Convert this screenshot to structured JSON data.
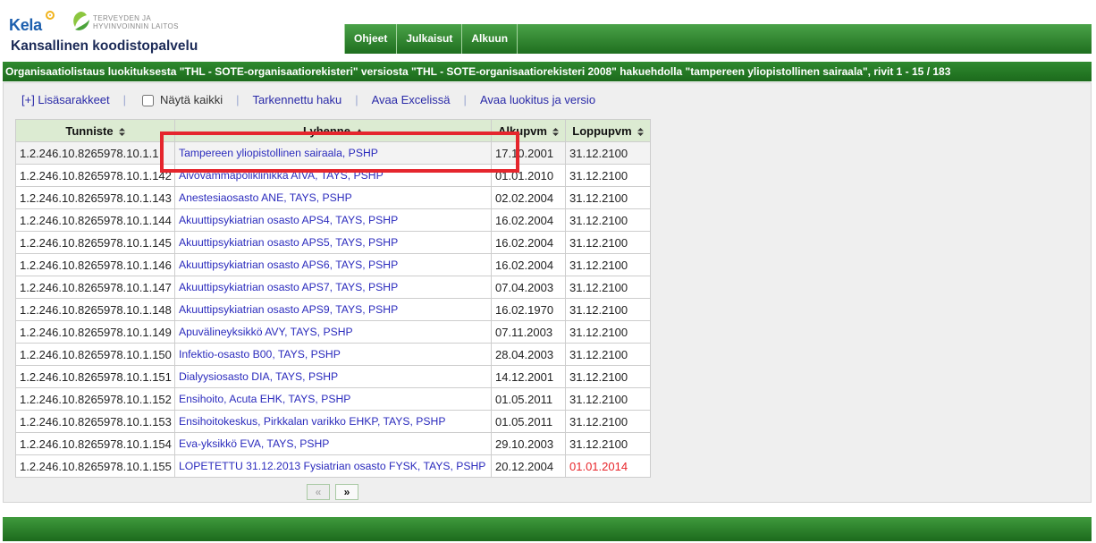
{
  "header": {
    "kela_logo_text": "Kela",
    "thl_logo_line1": "TERVEYDEN JA",
    "thl_logo_line2": "HYVINVOINNIN LAITOS",
    "app_title": "Kansallinen koodistopalvelu"
  },
  "nav": {
    "items": [
      {
        "label": "Ohjeet"
      },
      {
        "label": "Julkaisut"
      },
      {
        "label": "Alkuun"
      }
    ]
  },
  "title_bar": {
    "text": "Organisaatiolistaus luokituksesta \"THL - SOTE-organisaatiorekisteri\" versiosta \"THL - SOTE-organisaatiorekisteri 2008\" hakuehdolla \"tampereen yliopistollinen sairaala\", rivit 1 - 15 / 183"
  },
  "toolbar": {
    "more_columns": "[+] Lisäsarakkeet",
    "separator": "|",
    "show_all_label": "Näytä kaikki",
    "show_all_checked": false,
    "advanced_search": "Tarkennettu haku",
    "open_excel": "Avaa Excelissä",
    "open_classification": "Avaa luokitus ja versio"
  },
  "table": {
    "columns": [
      {
        "label": "Tunniste",
        "sort_icon": "sort-both-icon"
      },
      {
        "label": "Lyhenne",
        "sort_icon": "sort-asc-icon"
      },
      {
        "label": "Alkupvm",
        "sort_icon": "sort-both-icon"
      },
      {
        "label": "Loppupvm",
        "sort_icon": "sort-both-icon"
      }
    ],
    "rows": [
      {
        "id": "1.2.246.10.8265978.10.1.1",
        "name": "Tampereen yliopistollinen sairaala, PSHP",
        "start": "17.10.2001",
        "end": "31.12.2100",
        "end_expired": false
      },
      {
        "id": "1.2.246.10.8265978.10.1.142",
        "name": "Aivovammapoliklinikka AIVA, TAYS, PSHP",
        "start": "01.01.2010",
        "end": "31.12.2100",
        "end_expired": false
      },
      {
        "id": "1.2.246.10.8265978.10.1.143",
        "name": "Anestesiaosasto ANE, TAYS, PSHP",
        "start": "02.02.2004",
        "end": "31.12.2100",
        "end_expired": false
      },
      {
        "id": "1.2.246.10.8265978.10.1.144",
        "name": "Akuuttipsykiatrian osasto APS4, TAYS, PSHP",
        "start": "16.02.2004",
        "end": "31.12.2100",
        "end_expired": false
      },
      {
        "id": "1.2.246.10.8265978.10.1.145",
        "name": "Akuuttipsykiatrian osasto APS5, TAYS, PSHP",
        "start": "16.02.2004",
        "end": "31.12.2100",
        "end_expired": false
      },
      {
        "id": "1.2.246.10.8265978.10.1.146",
        "name": "Akuuttipsykiatrian osasto APS6, TAYS, PSHP",
        "start": "16.02.2004",
        "end": "31.12.2100",
        "end_expired": false
      },
      {
        "id": "1.2.246.10.8265978.10.1.147",
        "name": "Akuuttipsykiatrian osasto APS7, TAYS, PSHP",
        "start": "07.04.2003",
        "end": "31.12.2100",
        "end_expired": false
      },
      {
        "id": "1.2.246.10.8265978.10.1.148",
        "name": "Akuuttipsykiatrian osasto APS9, TAYS, PSHP",
        "start": "16.02.1970",
        "end": "31.12.2100",
        "end_expired": false
      },
      {
        "id": "1.2.246.10.8265978.10.1.149",
        "name": "Apuvälineyksikkö AVY, TAYS, PSHP",
        "start": "07.11.2003",
        "end": "31.12.2100",
        "end_expired": false
      },
      {
        "id": "1.2.246.10.8265978.10.1.150",
        "name": "Infektio-osasto B00, TAYS, PSHP",
        "start": "28.04.2003",
        "end": "31.12.2100",
        "end_expired": false
      },
      {
        "id": "1.2.246.10.8265978.10.1.151",
        "name": "Dialyysiosasto DIA, TAYS, PSHP",
        "start": "14.12.2001",
        "end": "31.12.2100",
        "end_expired": false
      },
      {
        "id": "1.2.246.10.8265978.10.1.152",
        "name": "Ensihoito, Acuta EHK, TAYS, PSHP",
        "start": "01.05.2011",
        "end": "31.12.2100",
        "end_expired": false
      },
      {
        "id": "1.2.246.10.8265978.10.1.153",
        "name": "Ensihoitokeskus, Pirkkalan varikko EHKP, TAYS, PSHP",
        "start": "01.05.2011",
        "end": "31.12.2100",
        "end_expired": false
      },
      {
        "id": "1.2.246.10.8265978.10.1.154",
        "name": "Eva-yksikkö EVA, TAYS, PSHP",
        "start": "29.10.2003",
        "end": "31.12.2100",
        "end_expired": false
      },
      {
        "id": "1.2.246.10.8265978.10.1.155",
        "name": "LOPETETTU 31.12.2013 Fysiatrian osasto FYSK, TAYS, PSHP",
        "start": "20.12.2004",
        "end": "01.01.2014",
        "end_expired": true
      }
    ]
  },
  "pagination": {
    "prev": "«",
    "next": "»",
    "prev_disabled": true
  },
  "colors": {
    "nav_green": "#2f862f",
    "table_header_green": "#dcebd2",
    "link_blue": "#2b2bbd",
    "expired_red": "#e8252a",
    "highlight_red": "#e5262d",
    "kela_blue": "#1d5fae"
  }
}
